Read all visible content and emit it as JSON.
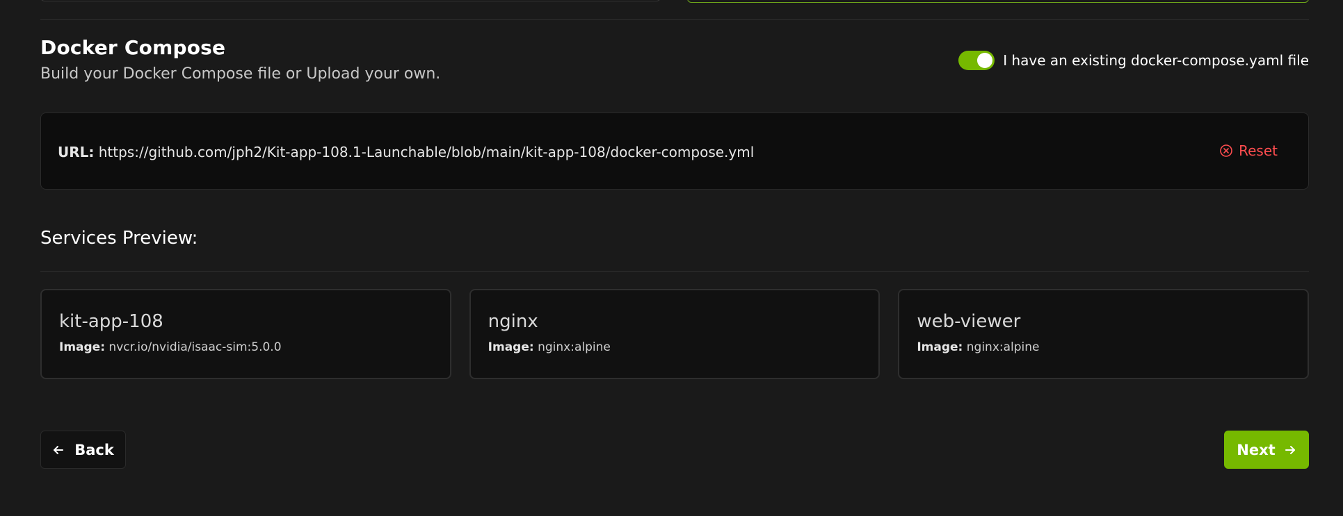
{
  "section": {
    "title": "Docker Compose",
    "subtitle": "Build your Docker Compose file or Upload your own."
  },
  "toggle": {
    "label": "I have an existing docker-compose.yaml file",
    "checked": true
  },
  "url_box": {
    "key": "URL:",
    "value": "https://github.com/jph2/Kit-app-108.1-Launchable/blob/main/kit-app-108/docker-compose.yml",
    "reset_label": "Reset"
  },
  "services": {
    "title": "Services Preview:",
    "image_key": "Image:",
    "items": [
      {
        "name": "kit-app-108",
        "image": "nvcr.io/nvidia/isaac-sim:5.0.0"
      },
      {
        "name": "nginx",
        "image": "nginx:alpine"
      },
      {
        "name": "web-viewer",
        "image": "nginx:alpine"
      }
    ]
  },
  "nav": {
    "back_label": "Back",
    "next_label": "Next"
  },
  "colors": {
    "accent": "#76b900",
    "danger": "#ff4d4f",
    "background": "#1a1a1a"
  },
  "icons": {
    "back": "arrow-left-icon",
    "next": "arrow-right-icon",
    "reset": "x-circle-icon"
  }
}
